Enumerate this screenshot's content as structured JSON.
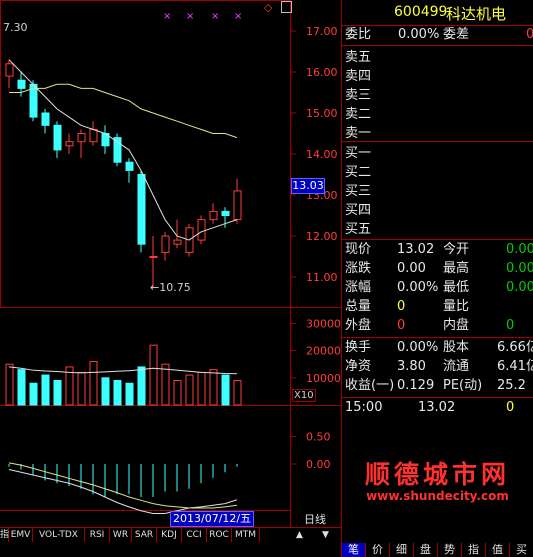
{
  "header": {
    "code": "600499",
    "name": "科达机电"
  },
  "top_left_price": "7.30",
  "top_marks": [
    "×",
    "×",
    "×",
    "×"
  ],
  "corner_symbol": "◇",
  "price_axis": [
    "17.00",
    "16.00",
    "15.00",
    "14.00",
    "13.00",
    "12.00",
    "11.00"
  ],
  "current_price_tag": "13.03",
  "low_marker": "10.75",
  "vol_axis": [
    "30000",
    "20000",
    "10000"
  ],
  "vol_unit": "X10",
  "macd_axis": [
    "0.50",
    "0.00"
  ],
  "date_tag": "2013/07/12/五",
  "period": "日线",
  "indicator_tabs": [
    "指",
    "EMV",
    "VOL-TDX",
    "RSI",
    "WR",
    "SAR",
    "KDJ",
    "CCI",
    "ROC",
    "MTM"
  ],
  "order_book": {
    "wei_bi_label": "委比",
    "wei_bi": "0.00%",
    "wei_cha_label": "委差",
    "wei_cha": "0",
    "sell": [
      "卖五",
      "卖四",
      "卖三",
      "卖二",
      "卖一"
    ],
    "buy": [
      "买一",
      "买二",
      "买三",
      "买四",
      "买五"
    ]
  },
  "stats": [
    {
      "l1": "现价",
      "v1": "13.02",
      "c1": "wht",
      "l2": "今开",
      "v2": "0.00",
      "c2": "grn"
    },
    {
      "l1": "涨跌",
      "v1": "0.00",
      "c1": "wht",
      "l2": "最高",
      "v2": "0.00",
      "c2": "grn"
    },
    {
      "l1": "涨幅",
      "v1": "0.00%",
      "c1": "wht",
      "l2": "最低",
      "v2": "0.00",
      "c2": "grn"
    },
    {
      "l1": "总量",
      "v1": "0",
      "c1": "yel",
      "l2": "量比",
      "v2": "",
      "c2": "wht"
    },
    {
      "l1": "外盘",
      "v1": "0",
      "c1": "red",
      "l2": "内盘",
      "v2": "0",
      "c2": "grn"
    }
  ],
  "stats2": [
    {
      "l1": "换手",
      "v1": "0.00%",
      "l2": "股本",
      "v2": "6.66亿"
    },
    {
      "l1": "净资",
      "v1": "3.80",
      "l2": "流通",
      "v2": "6.41亿"
    },
    {
      "l1": "收益(一)",
      "v1": "0.129",
      "l2": "PE(动)",
      "v2": "25.2"
    }
  ],
  "tick": {
    "time": "15:00",
    "price": "13.02",
    "vol": "0"
  },
  "watermark": {
    "title": "顺德城市网",
    "url": "www.shundecity.com"
  },
  "bottom_tabs": [
    "笔",
    "价",
    "细",
    "盘",
    "势",
    "指",
    "值",
    "买"
  ],
  "chart_data": [
    {
      "type": "candlestick",
      "title": "",
      "y_axis_ticks": [
        11.0,
        12.0,
        13.0,
        14.0,
        15.0,
        16.0,
        17.0
      ],
      "candles": [
        {
          "o": 15.9,
          "c": 16.2,
          "h": 16.3,
          "l": 15.6
        },
        {
          "o": 15.8,
          "c": 15.6,
          "h": 16.0,
          "l": 15.4
        },
        {
          "o": 15.7,
          "c": 14.9,
          "h": 15.8,
          "l": 14.8
        },
        {
          "o": 15.0,
          "c": 14.7,
          "h": 15.1,
          "l": 14.5
        },
        {
          "o": 14.7,
          "c": 14.1,
          "h": 14.8,
          "l": 13.9
        },
        {
          "o": 14.2,
          "c": 14.3,
          "h": 14.5,
          "l": 14.0
        },
        {
          "o": 14.3,
          "c": 14.5,
          "h": 14.6,
          "l": 13.9
        },
        {
          "o": 14.3,
          "c": 14.6,
          "h": 14.8,
          "l": 14.2
        },
        {
          "o": 14.5,
          "c": 14.2,
          "h": 14.7,
          "l": 14.0
        },
        {
          "o": 14.4,
          "c": 13.8,
          "h": 14.5,
          "l": 13.7
        },
        {
          "o": 13.8,
          "c": 13.6,
          "h": 13.9,
          "l": 13.3
        },
        {
          "o": 13.5,
          "c": 11.8,
          "h": 13.6,
          "l": 11.6
        },
        {
          "o": 11.5,
          "c": 11.5,
          "h": 12.0,
          "l": 10.75
        },
        {
          "o": 11.6,
          "c": 12.0,
          "h": 12.1,
          "l": 11.4
        },
        {
          "o": 11.8,
          "c": 11.9,
          "h": 12.4,
          "l": 11.7
        },
        {
          "o": 11.6,
          "c": 12.2,
          "h": 12.3,
          "l": 11.5
        },
        {
          "o": 11.9,
          "c": 12.4,
          "h": 12.5,
          "l": 11.8
        },
        {
          "o": 12.4,
          "c": 12.6,
          "h": 12.8,
          "l": 12.3
        },
        {
          "o": 12.6,
          "c": 12.5,
          "h": 12.7,
          "l": 12.2
        },
        {
          "o": 12.4,
          "c": 13.1,
          "h": 13.4,
          "l": 12.3
        }
      ],
      "ma_short": [
        16.3,
        16.0,
        15.7,
        15.4,
        15.1,
        14.9,
        14.7,
        14.6,
        14.5,
        14.3,
        14.1,
        13.6,
        13.0,
        12.4,
        12.0,
        11.9,
        12.1,
        12.2,
        12.3,
        12.4
      ],
      "ma_long": [
        15.5,
        15.5,
        15.6,
        15.6,
        15.7,
        15.7,
        15.6,
        15.6,
        15.5,
        15.4,
        15.3,
        15.1,
        15.0,
        14.9,
        14.8,
        14.7,
        14.6,
        14.5,
        14.5,
        14.4
      ]
    },
    {
      "type": "bar",
      "title": "",
      "y_axis_ticks": [
        10000,
        20000,
        30000
      ],
      "values": [
        15000,
        13000,
        8000,
        11000,
        9000,
        14000,
        12000,
        16000,
        10000,
        9000,
        8000,
        14000,
        22000,
        15000,
        9000,
        11000,
        12000,
        13000,
        11000,
        9000
      ],
      "ma": [
        14000,
        13500,
        12800,
        12500,
        12300,
        12000,
        11800,
        12000,
        12200,
        12400,
        12600,
        13000,
        13500,
        13200,
        12800,
        12400,
        12000,
        11800,
        11600,
        11500
      ]
    },
    {
      "type": "bar",
      "title": "",
      "y_axis_ticks": [
        0.0,
        0.5
      ],
      "values": [
        -0.05,
        -0.1,
        -0.2,
        -0.3,
        -0.35,
        -0.4,
        -0.45,
        -0.55,
        -0.6,
        -0.55,
        -0.55,
        -0.6,
        -0.6,
        -0.5,
        -0.5,
        -0.45,
        -0.35,
        -0.25,
        -0.15,
        -0.05
      ],
      "dif": [
        -0.1,
        -0.15,
        -0.2,
        -0.25,
        -0.3,
        -0.35,
        -0.42,
        -0.5,
        -0.6,
        -0.7,
        -0.78,
        -0.85,
        -0.9,
        -0.9,
        -0.85,
        -0.8,
        -0.78,
        -0.75,
        -0.72,
        -0.65
      ],
      "dea": [
        0.02,
        -0.02,
        -0.08,
        -0.14,
        -0.2,
        -0.26,
        -0.32,
        -0.38,
        -0.45,
        -0.52,
        -0.6,
        -0.66,
        -0.72,
        -0.76,
        -0.78,
        -0.8,
        -0.8,
        -0.8,
        -0.78,
        -0.75
      ]
    }
  ]
}
